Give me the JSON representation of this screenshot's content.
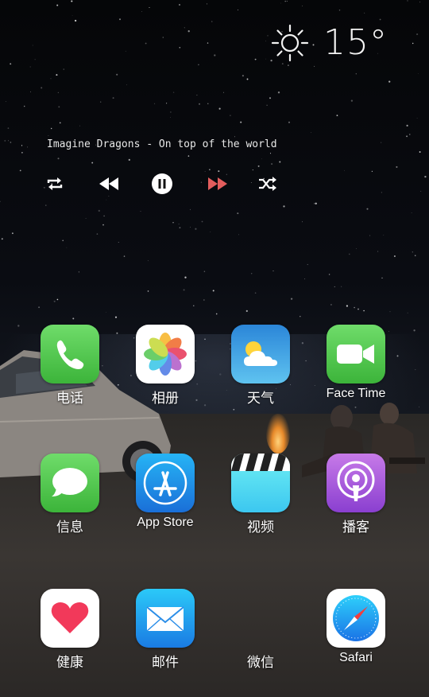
{
  "weather": {
    "icon": "sun-icon",
    "temperature": "15°"
  },
  "music": {
    "track": "Imagine Dragons - On top of the world",
    "controls": [
      "repeat-icon",
      "rewind-icon",
      "pause-icon",
      "fast-forward-icon",
      "shuffle-icon"
    ],
    "accent_color": "#e35d5d"
  },
  "apps": {
    "row1": [
      {
        "label": "电话",
        "icon": "phone-icon"
      },
      {
        "label": "相册",
        "icon": "photos-icon"
      },
      {
        "label": "天气",
        "icon": "weather-icon"
      },
      {
        "label": "Face Time",
        "icon": "facetime-icon"
      }
    ],
    "row2": [
      {
        "label": "信息",
        "icon": "messages-icon"
      },
      {
        "label": "App Store",
        "icon": "appstore-icon"
      },
      {
        "label": "视频",
        "icon": "videos-icon"
      },
      {
        "label": "播客",
        "icon": "podcasts-icon"
      }
    ],
    "row3": [
      {
        "label": "健康",
        "icon": "health-icon"
      },
      {
        "label": "邮件",
        "icon": "mail-icon"
      },
      {
        "label": "微信",
        "icon": "wechat-icon"
      },
      {
        "label": "Safari",
        "icon": "safari-icon"
      }
    ]
  }
}
